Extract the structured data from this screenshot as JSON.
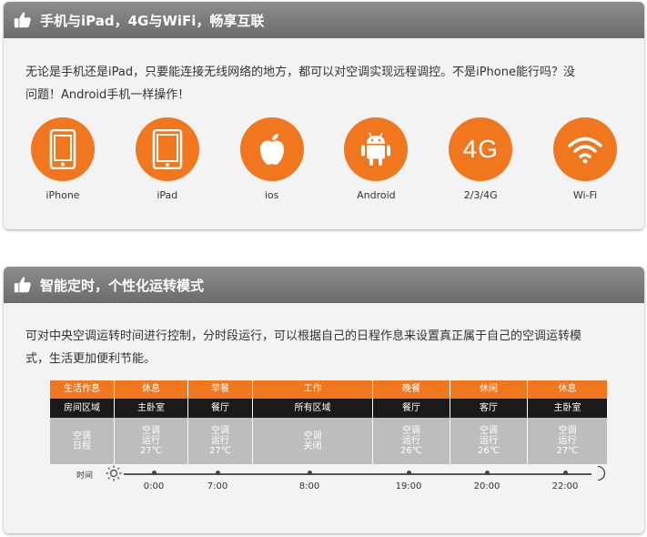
{
  "section1": {
    "title": "手机与iPad，4G与WiFi，畅享互联",
    "desc_line1": "无论是手机还是iPad，只要能连接无线网络的地方，都可以对空调实现远程调控。不是iPhone能行吗？没",
    "desc_line2": "问题！Android手机一样操作！",
    "icons": [
      {
        "label": "iPhone",
        "icon": "phone-icon"
      },
      {
        "label": "iPad",
        "icon": "tablet-icon"
      },
      {
        "label": "ios",
        "icon": "apple-icon"
      },
      {
        "label": "Android",
        "icon": "android-icon"
      },
      {
        "label": "2/3/4G",
        "icon": "4g-icon",
        "glyph": "4G"
      },
      {
        "label": "Wi-Fi",
        "icon": "wifi-icon"
      }
    ],
    "accent": "#f0771e"
  },
  "section2": {
    "title": "智能定时，个性化运转模式",
    "desc_line1": "可对中央空调运转时间进行控制，分时段运行，可以根据自己的日程作息来设置真正属于自己的空调运转模",
    "desc_line2": "式，生活更加便利节能。",
    "schedule": {
      "header_activity": "生活作息",
      "header_area": "房间区域",
      "header_state_1": "空调",
      "header_state_2": "日程",
      "columns": [
        {
          "activity": "休息",
          "area": "主卧室",
          "state": [
            "空调",
            "运行",
            "27℃"
          ]
        },
        {
          "activity": "早餐",
          "area": "餐厅",
          "state": [
            "空调",
            "运行",
            "27℃"
          ]
        },
        {
          "activity": "工作",
          "area": "所有区域",
          "state": [
            "空调",
            "关闭"
          ]
        },
        {
          "activity": "晚餐",
          "area": "餐厅",
          "state": [
            "空调",
            "运行",
            "26℃"
          ]
        },
        {
          "activity": "休闲",
          "area": "客厅",
          "state": [
            "空调",
            "运行",
            "26℃"
          ]
        },
        {
          "activity": "休息",
          "area": "主卧室",
          "state": [
            "空调",
            "运行",
            "27℃"
          ]
        }
      ]
    },
    "timeline": {
      "label": "时间",
      "times": [
        "0:00",
        "7:00",
        "8:00",
        "19:00",
        "20:00",
        "22:00"
      ]
    }
  }
}
